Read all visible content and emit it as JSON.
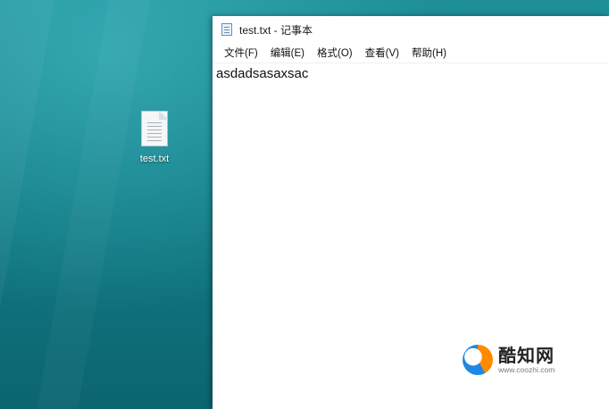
{
  "desktop": {
    "file_icon": {
      "label": "test.txt",
      "icon": "text-file-icon"
    }
  },
  "notepad": {
    "title": "test.txt - 记事本",
    "app_icon": "notepad-icon",
    "menu": {
      "items": [
        {
          "label": "文件(F)"
        },
        {
          "label": "编辑(E)"
        },
        {
          "label": "格式(O)"
        },
        {
          "label": "查看(V)"
        },
        {
          "label": "帮助(H)"
        }
      ]
    },
    "editor": {
      "content": "asdadsasaxsac"
    }
  },
  "watermark": {
    "name": "酷知网",
    "url": "www.coozhi.com",
    "logo": "coozhi-logo"
  },
  "colors": {
    "desktop_teal": "#137c86",
    "window_bg": "#ffffff",
    "logo_orange": "#ff8a00",
    "logo_blue": "#1e88e5"
  }
}
